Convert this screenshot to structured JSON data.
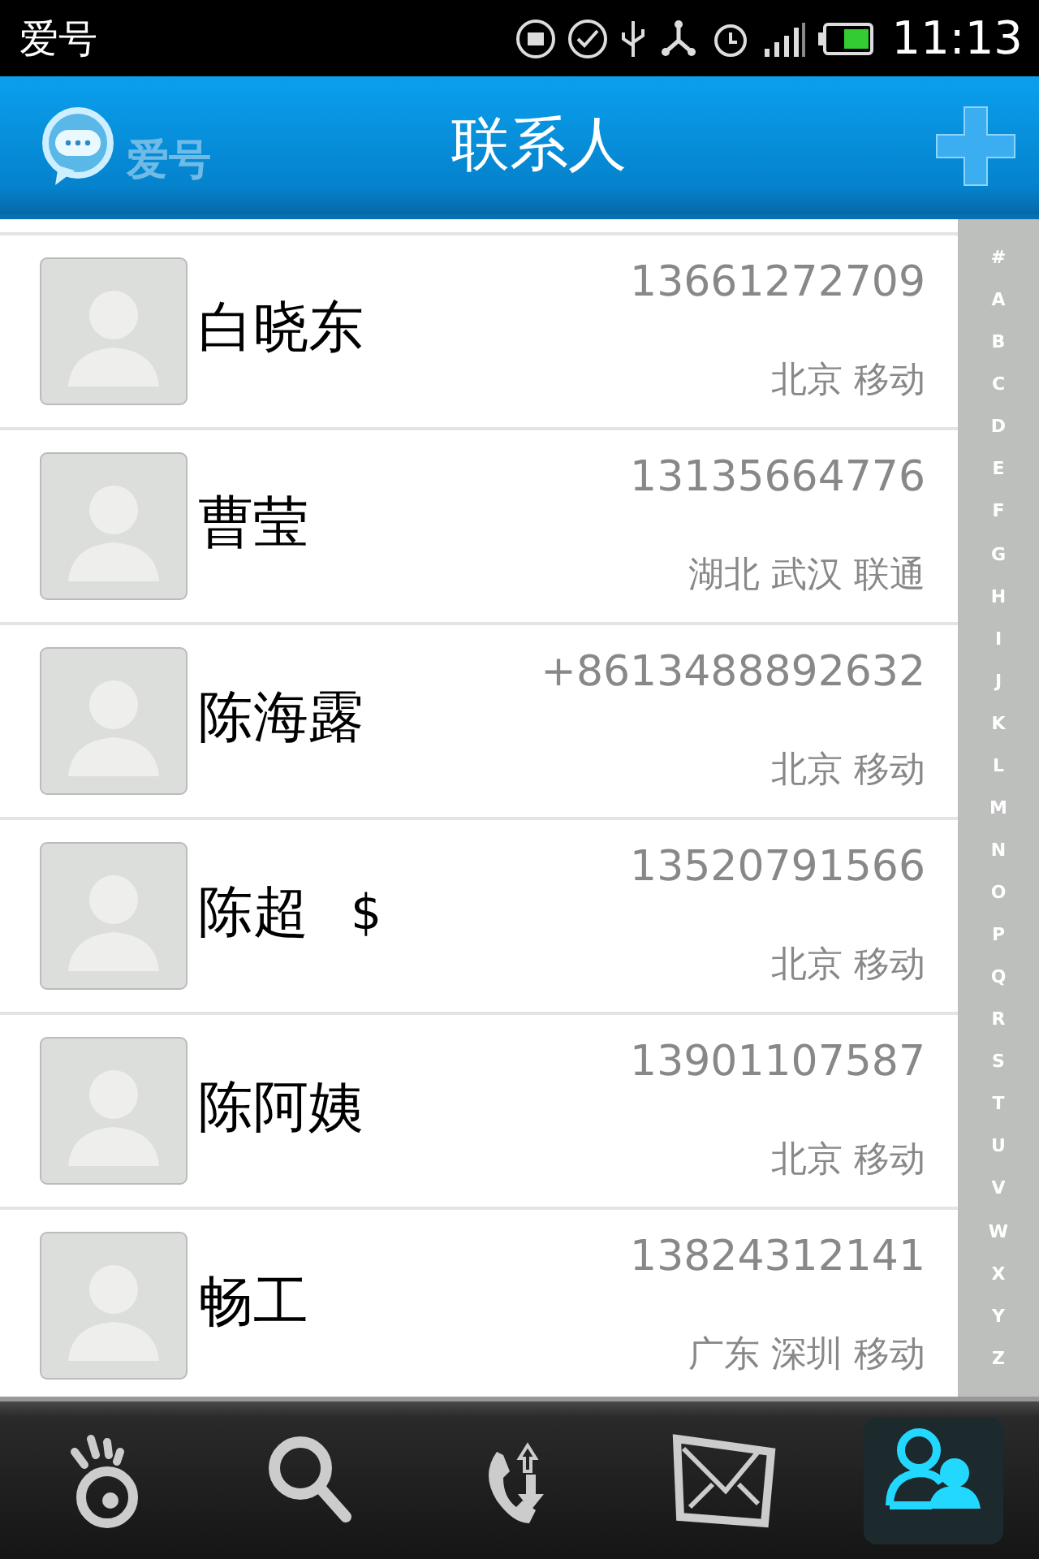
{
  "status_bar": {
    "app_name": "爱号",
    "time": "11:13"
  },
  "header": {
    "logo_text": "爱号",
    "title": "联系人"
  },
  "contacts": [
    {
      "name": "白晓东",
      "phone": "13661272709",
      "location": "北京 移动"
    },
    {
      "name": "曹莹",
      "phone": "13135664776",
      "location": "湖北 武汉 联通"
    },
    {
      "name": "陈海露",
      "phone": "+8613488892632",
      "location": "北京 移动"
    },
    {
      "name": "陈超",
      "badge": "$",
      "phone": "13520791566",
      "location": "北京 移动"
    },
    {
      "name": "陈阿姨",
      "phone": "13901107587",
      "location": "北京 移动"
    },
    {
      "name": "畅工",
      "phone": "13824312141",
      "location": "广东 深圳 移动"
    }
  ],
  "index_letters": [
    "#",
    "A",
    "B",
    "C",
    "D",
    "E",
    "F",
    "G",
    "H",
    "I",
    "J",
    "K",
    "L",
    "M",
    "N",
    "O",
    "P",
    "Q",
    "R",
    "S",
    "T",
    "U",
    "V",
    "W",
    "X",
    "Y",
    "Z"
  ],
  "tabs": [
    {
      "kind": "eye",
      "selected": false
    },
    {
      "kind": "search",
      "selected": false
    },
    {
      "kind": "calls",
      "selected": false
    },
    {
      "kind": "messages",
      "selected": false
    },
    {
      "kind": "contacts",
      "selected": true
    }
  ]
}
